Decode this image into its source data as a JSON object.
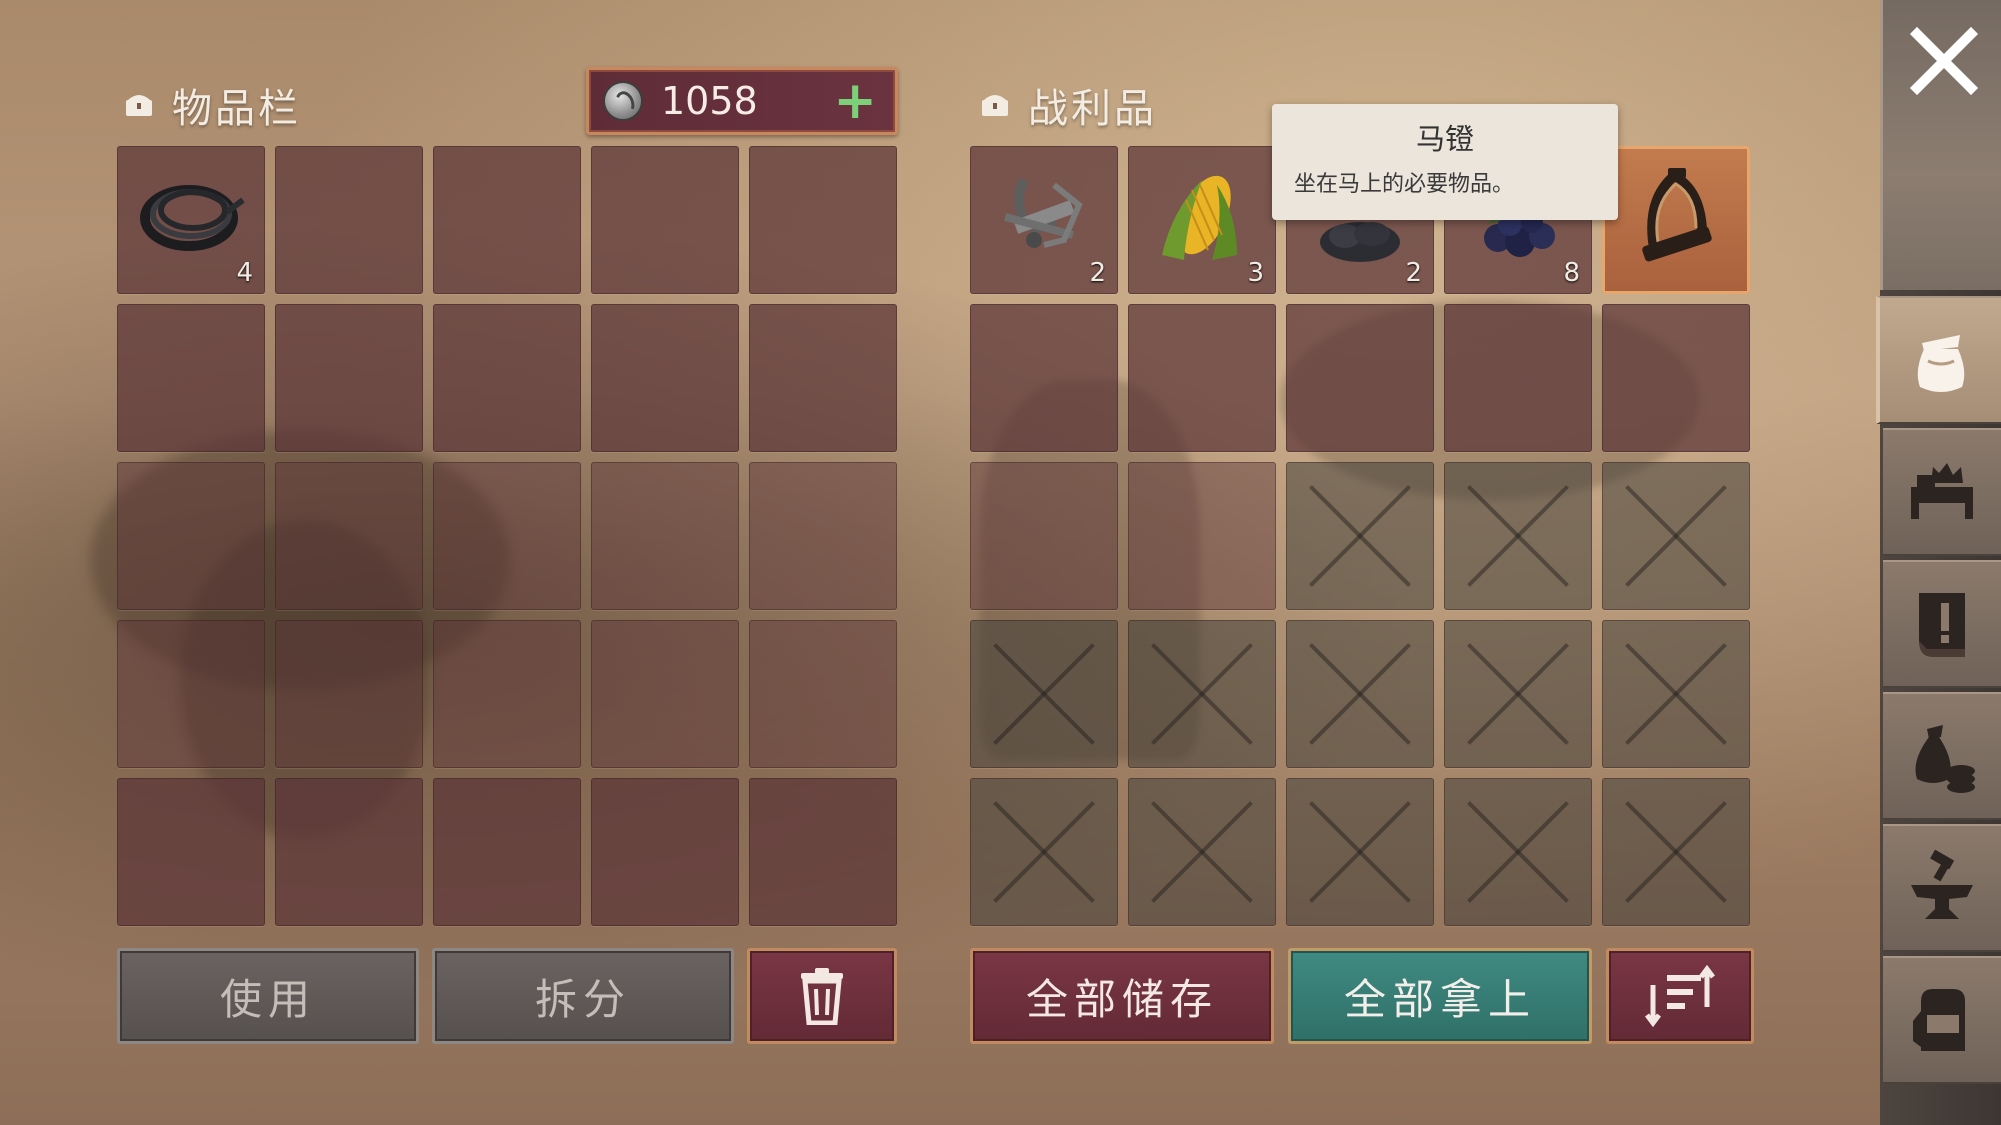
{
  "inventory": {
    "title": "物品栏",
    "currency_amount": "1058",
    "currency_add": "+",
    "slots": [
      {
        "item": "rope",
        "count": "4"
      }
    ],
    "use_label": "使用",
    "split_label": "拆分"
  },
  "loot": {
    "title": "战利品",
    "slots": [
      {
        "item": "scrap-metal",
        "count": "2"
      },
      {
        "item": "corn",
        "count": "3"
      },
      {
        "item": "coal",
        "count": "2"
      },
      {
        "item": "berries",
        "count": "8"
      },
      {
        "item": "stirrup",
        "count": ""
      }
    ],
    "store_all_label": "全部储存",
    "take_all_label": "全部拿上"
  },
  "tooltip": {
    "title": "马镫",
    "description": "坐在马上的必要物品。"
  },
  "sidebar": {
    "tabs": [
      "bag-icon",
      "bed-icon",
      "quest-book-icon",
      "money-bag-icon",
      "anvil-icon",
      "backpack-icon"
    ],
    "active": "bag-icon"
  },
  "colors": {
    "slot": "#5c3438",
    "accent_teal": "#3f8a82",
    "accent_maroon": "#7a3644",
    "selected": "#c37c4e",
    "plus": "#7cd07a"
  }
}
